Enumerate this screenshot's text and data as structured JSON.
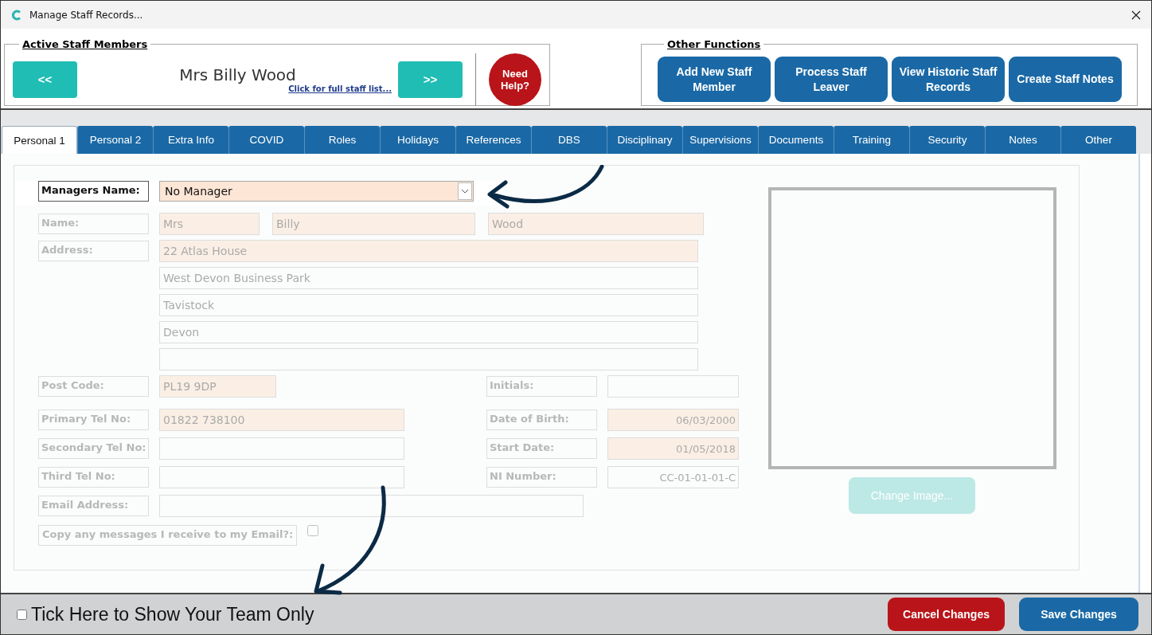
{
  "window": {
    "title": "Manage Staff Records..."
  },
  "staff_panel": {
    "legend": "Active Staff Members",
    "prev_button": "<<",
    "staff_name": "Mrs Billy Wood",
    "list_link": "Click for full staff list...",
    "next_button": ">>",
    "help_button": "Need Help?"
  },
  "functions_panel": {
    "legend": "Other Functions",
    "buttons": [
      "Add New Staff Member",
      "Process Staff Leaver",
      "View Historic Staff Records",
      "Create Staff Notes"
    ]
  },
  "tabs": [
    {
      "label": "Personal 1",
      "selected": true
    },
    {
      "label": "Personal 2",
      "selected": false
    },
    {
      "label": "Extra Info",
      "selected": false
    },
    {
      "label": "COVID",
      "selected": false
    },
    {
      "label": "Roles",
      "selected": false
    },
    {
      "label": "Holidays",
      "selected": false
    },
    {
      "label": "References",
      "selected": false
    },
    {
      "label": "DBS",
      "selected": false
    },
    {
      "label": "Disciplinary",
      "selected": false
    },
    {
      "label": "Supervisions",
      "selected": false
    },
    {
      "label": "Documents",
      "selected": false
    },
    {
      "label": "Training",
      "selected": false
    },
    {
      "label": "Security",
      "selected": false
    },
    {
      "label": "Notes",
      "selected": false
    },
    {
      "label": "Other",
      "selected": false
    }
  ],
  "form": {
    "manager": {
      "label": "Managers Name:",
      "value": "No Manager",
      "disabled": false
    },
    "name": {
      "label": "Name:",
      "disabled": true,
      "fields": [
        {
          "value": "Mrs",
          "required": true
        },
        {
          "value": "Billy",
          "required": true
        },
        {
          "value": "Wood",
          "required": true
        }
      ]
    },
    "address": {
      "label": "Address:",
      "disabled": true,
      "lines": [
        {
          "value": "22 Atlas House",
          "required": true
        },
        {
          "value": "West Devon Business Park",
          "required": false
        },
        {
          "value": "Tavistock",
          "required": false
        },
        {
          "value": "Devon",
          "required": false
        },
        {
          "required": false
        }
      ]
    },
    "post_code": {
      "label": "Post Code:",
      "value": "PL19 9DP",
      "required": true,
      "disabled": true
    },
    "initials": {
      "label": "Initials:",
      "required": false,
      "disabled": true
    },
    "primary_tel": {
      "label": "Primary Tel No:",
      "value": "01822 738100",
      "required": true,
      "disabled": true
    },
    "date_of_birth": {
      "label": "Date of Birth:",
      "value": "06/03/2000",
      "required": true,
      "disabled": true
    },
    "secondary_tel": {
      "label": "Secondary Tel No:",
      "required": false,
      "disabled": true
    },
    "start_date": {
      "label": "Start Date:",
      "value": "01/05/2018",
      "required": true,
      "disabled": true
    },
    "third_tel": {
      "label": "Third Tel No:",
      "required": false,
      "disabled": true
    },
    "ni_number": {
      "label": "NI Number:",
      "value": "CC-01-01-01-C",
      "required": false,
      "disabled": true
    },
    "email": {
      "label": "Email Address:",
      "required": false,
      "disabled": true
    },
    "copy_messages": {
      "label": "Copy any messages I receive to my Email?:",
      "checked": false,
      "disabled": true
    },
    "photo": {
      "change_button": "Change Image...",
      "disabled": true
    }
  },
  "footer": {
    "team_only": {
      "label": "Tick Here to Show Your Team Only",
      "checked": false
    },
    "cancel_button": "Cancel Changes",
    "save_button": "Save Changes"
  }
}
